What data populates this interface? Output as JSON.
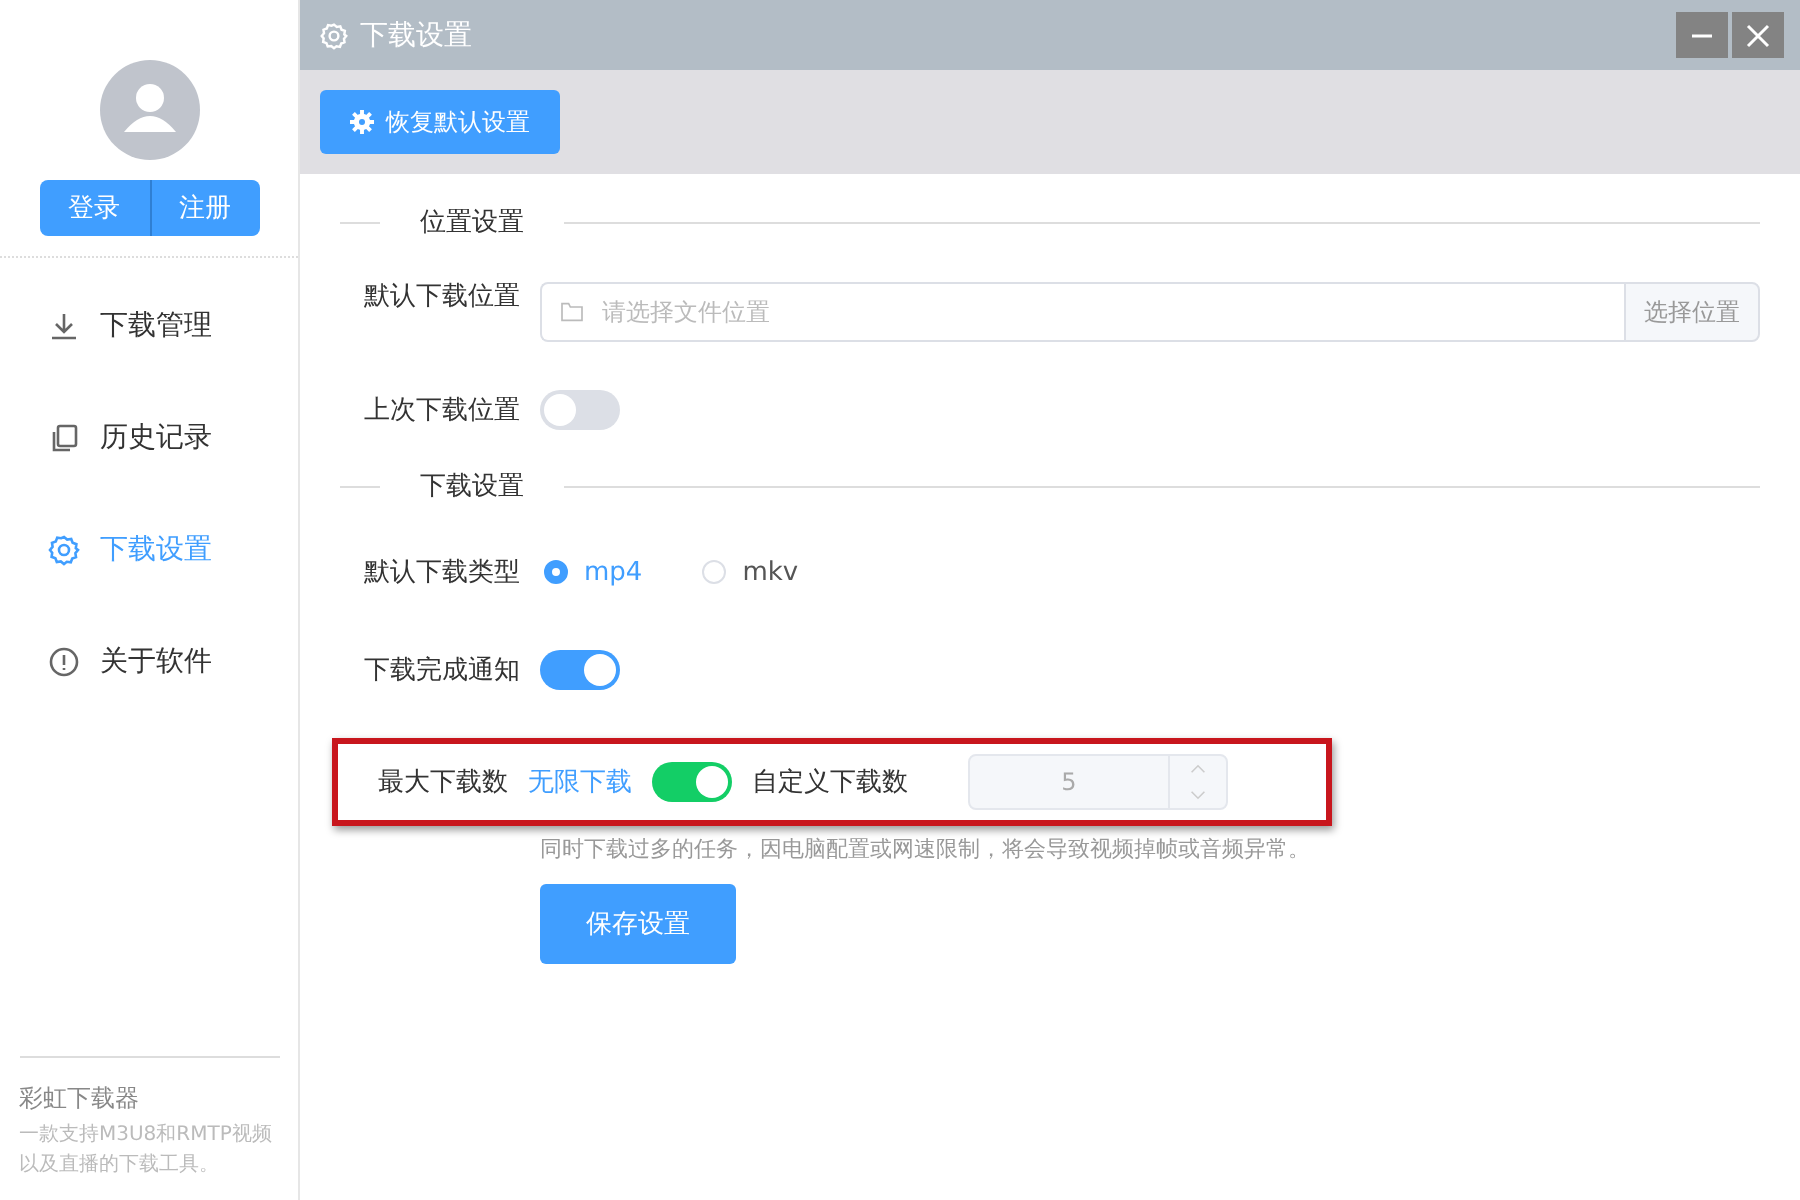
{
  "sidebar": {
    "auth_buttons": [
      "登录",
      "注册"
    ],
    "items": [
      {
        "label": "下载管理",
        "kind": "download",
        "selected": false
      },
      {
        "label": "历史记录",
        "kind": "history",
        "selected": false
      },
      {
        "label": "下载设置",
        "kind": "settings",
        "selected": true
      },
      {
        "label": "关于软件",
        "kind": "about",
        "selected": false
      }
    ],
    "app_name": "彩虹下载器",
    "app_description": "一款支持M3U8和RMTP视频以及直播的下载工具。"
  },
  "window": {
    "title": "下载设置"
  },
  "toolbar": {
    "reset_button": "恢复默认设置"
  },
  "sections": [
    {
      "title": "位置设置"
    },
    {
      "title": "下载设置"
    }
  ],
  "location": {
    "label": "默认下载位置",
    "placeholder": "请选择文件位置",
    "button": "选择位置"
  },
  "last_location": {
    "label": "上次下载位置",
    "on": false
  },
  "type": {
    "label": "默认下载类型",
    "options": [
      {
        "label": "mp4",
        "selected": true
      },
      {
        "label": "mkv",
        "selected": false
      }
    ]
  },
  "notify": {
    "label": "下载完成通知",
    "on": true
  },
  "max_downloads": {
    "label": "最大下载数",
    "unlimited_label": "无限下载",
    "unlimited_on": true,
    "custom_label": "自定义下载数",
    "value": "5",
    "hint": "同时下载过多的任务，因电脑配置或网速限制，将会导致视频掉帧或音频异常。",
    "highlighted": true
  },
  "save_button": "保存设置"
}
